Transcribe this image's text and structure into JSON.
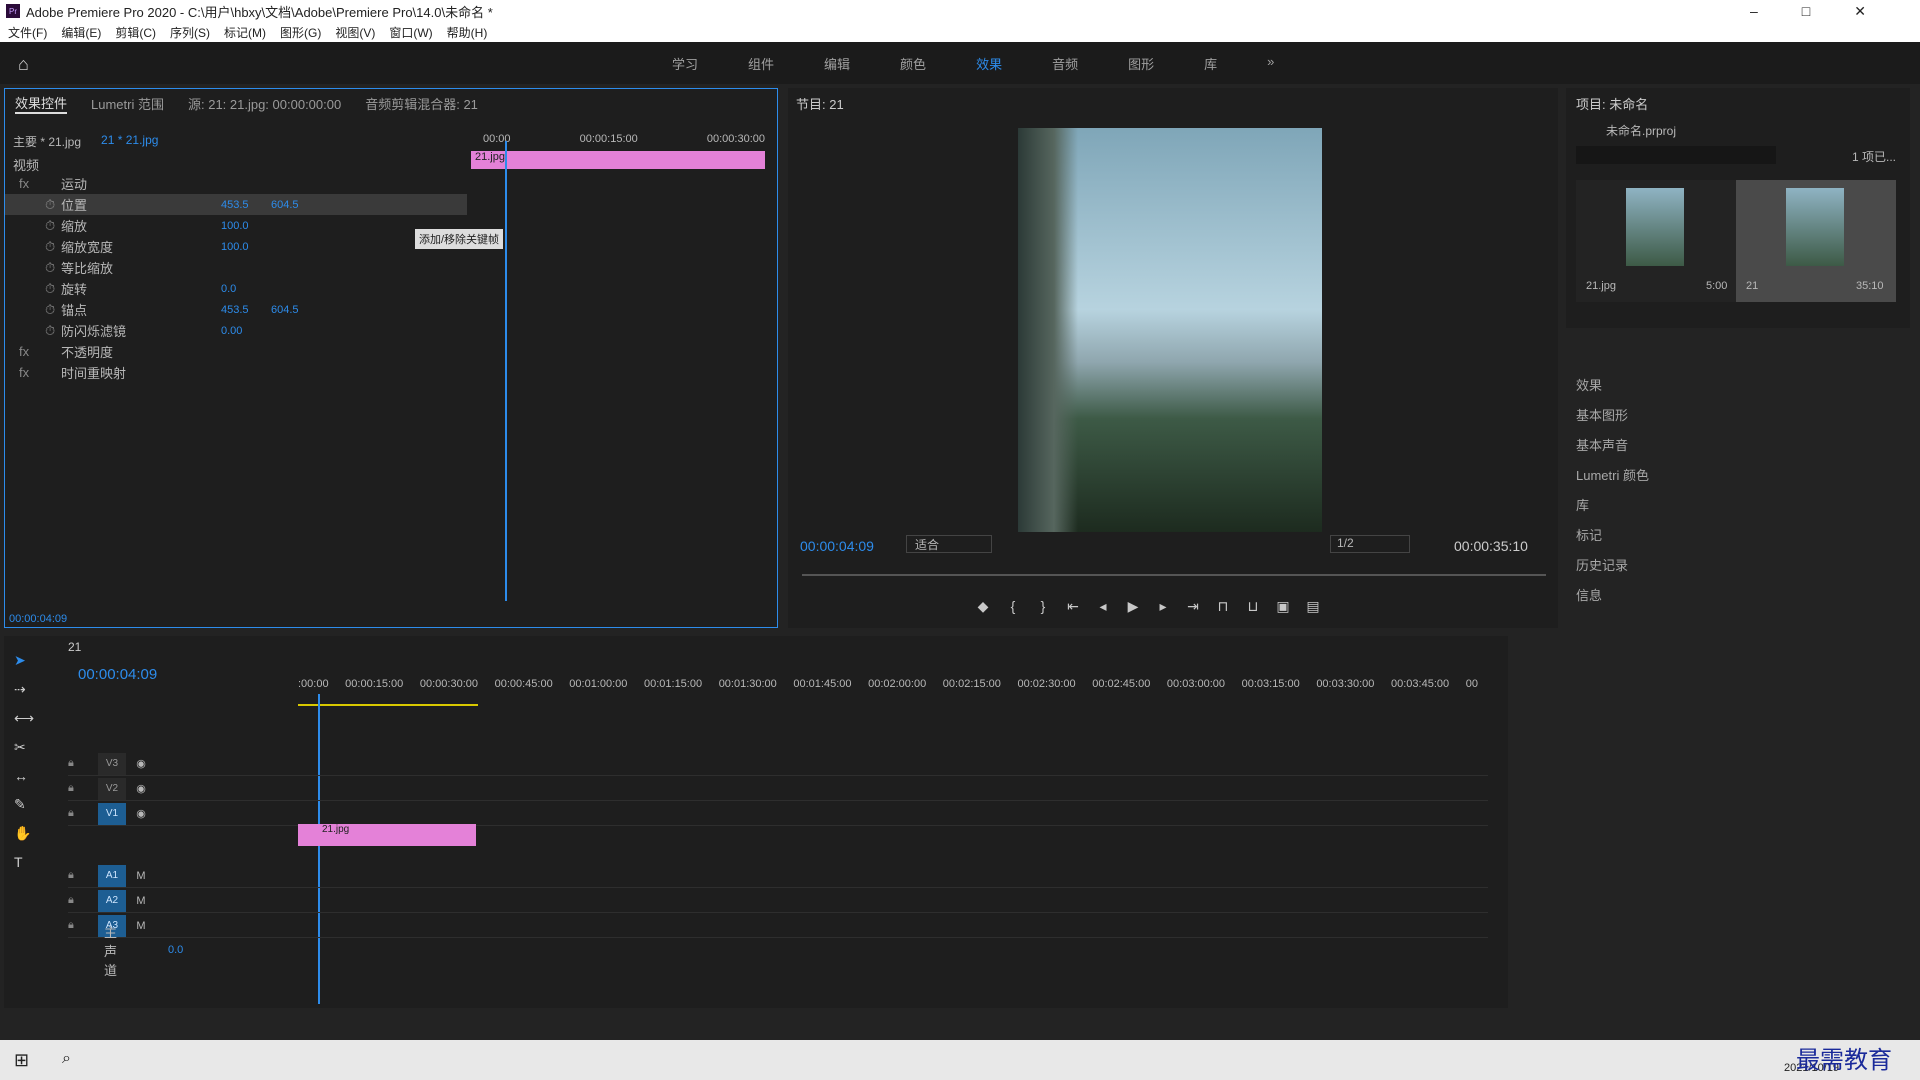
{
  "titlebar": {
    "title": "Adobe Premiere Pro 2020 - C:\\用户\\hbxy\\文档\\Adobe\\Premiere Pro\\14.0\\未命名 *"
  },
  "menu": [
    "文件(F)",
    "编辑(E)",
    "剪辑(C)",
    "序列(S)",
    "标记(M)",
    "图形(G)",
    "视图(V)",
    "窗口(W)",
    "帮助(H)"
  ],
  "workspaces": [
    "学习",
    "组件",
    "编辑",
    "颜色",
    "效果",
    "音频",
    "图形",
    "库"
  ],
  "active_workspace": "效果",
  "effect_controls": {
    "tabs": [
      "效果控件",
      "Lumetri 范围",
      "源: 21: 21.jpg: 00:00:00:00",
      "音频剪辑混合器: 21"
    ],
    "master": "主要 * 21.jpg",
    "clip": "21 * 21.jpg",
    "section": "视频",
    "ruler": [
      "00:00",
      "00:00:15:00",
      "00:00:30:00"
    ],
    "clip_label": "21.jpg",
    "rows": [
      {
        "label": "运动",
        "v1": "",
        "v2": ""
      },
      {
        "label": "位置",
        "v1": "453.5",
        "v2": "604.5"
      },
      {
        "label": "缩放",
        "v1": "100.0",
        "v2": ""
      },
      {
        "label": "缩放宽度",
        "v1": "100.0",
        "v2": ""
      },
      {
        "label": "等比缩放",
        "v1": "",
        "v2": ""
      },
      {
        "label": "旋转",
        "v1": "0.0",
        "v2": ""
      },
      {
        "label": "锚点",
        "v1": "453.5",
        "v2": "604.5"
      },
      {
        "label": "防闪烁滤镜",
        "v1": "0.00",
        "v2": ""
      },
      {
        "label": "不透明度",
        "v1": "",
        "v2": ""
      },
      {
        "label": "时间重映射",
        "v1": "",
        "v2": ""
      }
    ],
    "tooltip": "添加/移除关键帧",
    "timecode": "00:00:04:09"
  },
  "program": {
    "title": "节目: 21",
    "timecode": "00:00:04:09",
    "fit": "适合",
    "quality": "1/2",
    "duration": "00:00:35:10"
  },
  "project": {
    "title": "项目: 未命名",
    "file": "未命名.prproj",
    "count": "1 项已...",
    "items": [
      {
        "name": "21.jpg",
        "dur": "5:00"
      },
      {
        "name": "21",
        "dur": "35:10"
      }
    ]
  },
  "right_panels": [
    "效果",
    "基本图形",
    "基本声音",
    "Lumetri 颜色",
    "库",
    "标记",
    "历史记录",
    "信息"
  ],
  "timeline": {
    "tab": "21",
    "timecode": "00:00:04:09",
    "ruler": [
      ":00:00",
      "00:00:15:00",
      "00:00:30:00",
      "00:00:45:00",
      "00:01:00:00",
      "00:01:15:00",
      "00:01:30:00",
      "00:01:45:00",
      "00:02:00:00",
      "00:02:15:00",
      "00:02:30:00",
      "00:02:45:00",
      "00:03:00:00",
      "00:03:15:00",
      "00:03:30:00",
      "00:03:45:00",
      "00"
    ],
    "video_tracks": [
      "V3",
      "V2",
      "V1"
    ],
    "audio_tracks": [
      "A1",
      "A2",
      "A3"
    ],
    "master": "主声道",
    "master_val": "0.0",
    "clip": "21.jpg"
  },
  "taskbar": {
    "date": "2021/10/19",
    "watermark": "最需教育"
  }
}
